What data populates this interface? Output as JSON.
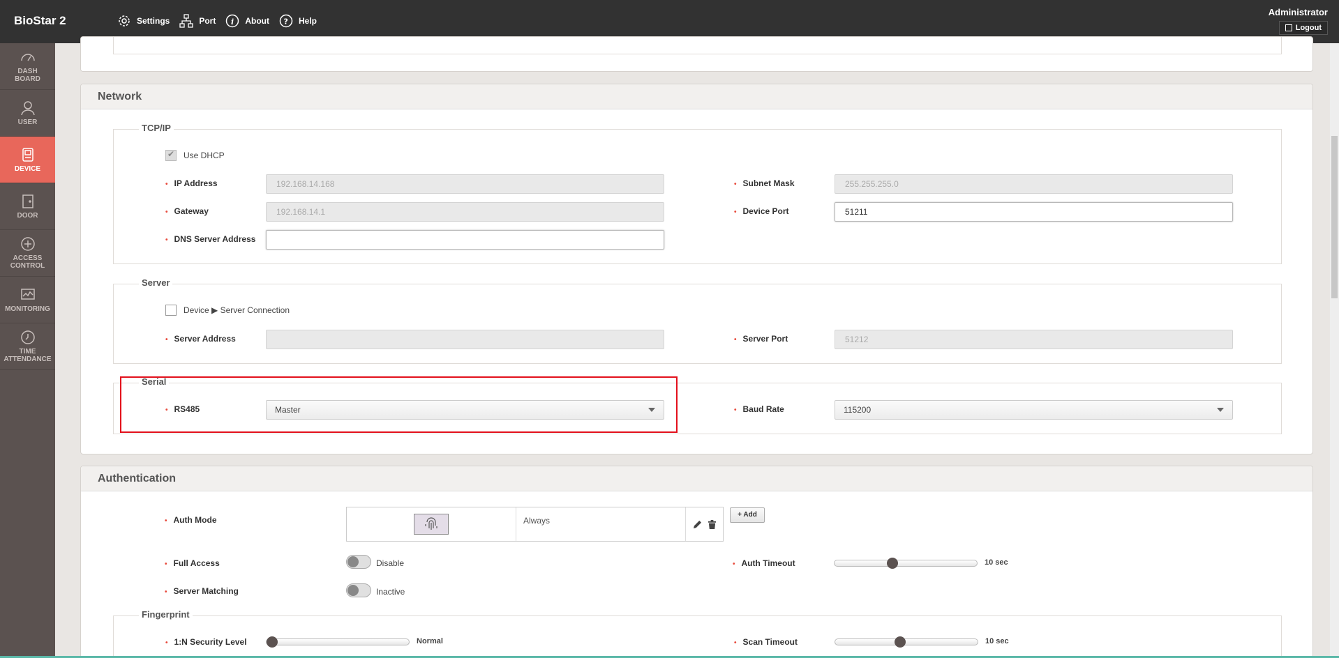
{
  "app": {
    "brand": "BioStar 2"
  },
  "topnav": [
    {
      "label": "Settings",
      "icon": "gear-icon"
    },
    {
      "label": "Port",
      "icon": "network-icon"
    },
    {
      "label": "About",
      "icon": "info-icon"
    },
    {
      "label": "Help",
      "icon": "help-icon"
    }
  ],
  "user": {
    "name": "Administrator",
    "logout": "Logout"
  },
  "sidebar": [
    {
      "label1": "DASH",
      "label2": "BOARD",
      "icon": "dashboard-icon"
    },
    {
      "label1": "USER",
      "label2": "",
      "icon": "user-icon"
    },
    {
      "label1": "DEVICE",
      "label2": "",
      "icon": "device-icon",
      "active": true
    },
    {
      "label1": "DOOR",
      "label2": "",
      "icon": "door-icon"
    },
    {
      "label1": "ACCESS",
      "label2": "CONTROL",
      "icon": "access-control-icon"
    },
    {
      "label1": "MONITORING",
      "label2": "",
      "icon": "monitoring-icon"
    },
    {
      "label1": "TIME",
      "label2": "ATTENDANCE",
      "icon": "time-attendance-icon"
    }
  ],
  "network": {
    "title": "Network",
    "tcpip": {
      "title": "TCP/IP",
      "use_dhcp": "Use DHCP",
      "ip_label": "IP Address",
      "ip_value": "192.168.14.168",
      "subnet_label": "Subnet Mask",
      "subnet_value": "255.255.255.0",
      "gateway_label": "Gateway",
      "gateway_value": "192.168.14.1",
      "port_label": "Device Port",
      "port_value": "51211",
      "dns_label": "DNS Server Address",
      "dns_value": ""
    },
    "server": {
      "title": "Server",
      "conn_prefix": "Device",
      "conn_suffix": "Server Connection",
      "address_label": "Server Address",
      "address_value": "",
      "port_label": "Server Port",
      "port_value": "51212"
    },
    "serial": {
      "title": "Serial",
      "rs485_label": "RS485",
      "rs485_value": "Master",
      "baud_label": "Baud Rate",
      "baud_value": "115200"
    }
  },
  "authentication": {
    "title": "Authentication",
    "auth_mode_label": "Auth Mode",
    "auth_mode_schedule": "Always",
    "add_label": "+ Add",
    "full_access_label": "Full Access",
    "full_access_value": "Disable",
    "auth_timeout_label": "Auth Timeout",
    "auth_timeout_value": "10 sec",
    "auth_timeout_level": 0.4,
    "server_matching_label": "Server Matching",
    "server_matching_value": "Inactive",
    "fingerprint": {
      "title": "Fingerprint",
      "security_label": "1:N Security Level",
      "security_value": "Normal",
      "security_level": 0.0,
      "scan_timeout_label": "Scan Timeout",
      "scan_timeout_value": "10 sec",
      "scan_timeout_level": 0.45
    }
  },
  "colors": {
    "accent": "#e8675b",
    "required": "#e84a3c",
    "highlight": "#e3101c",
    "topbar": "#323232",
    "sidebar": "#5b5250"
  }
}
